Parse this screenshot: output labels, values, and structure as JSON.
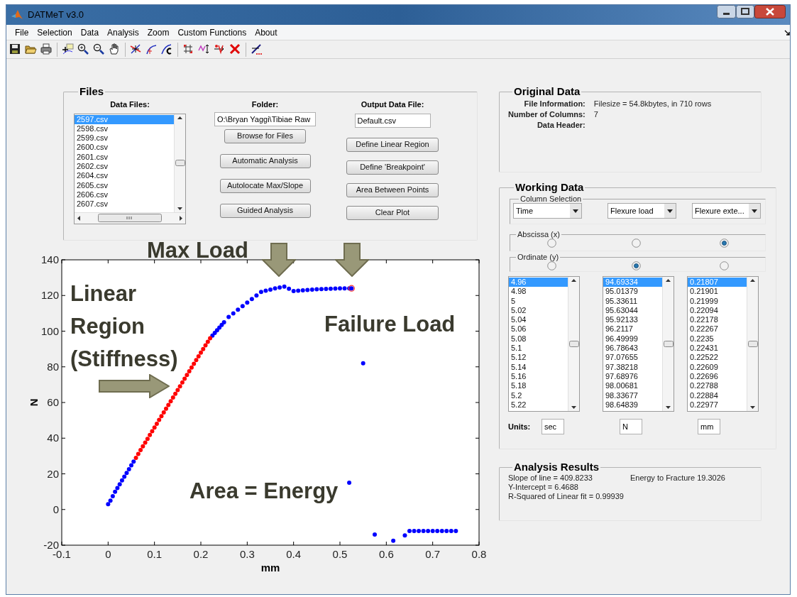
{
  "window": {
    "title": "DATMeT v3.0"
  },
  "menu": [
    "File",
    "Selection",
    "Data",
    "Analysis",
    "Zoom",
    "Custom Functions",
    "About"
  ],
  "files": {
    "title": "Files",
    "data_files_label": "Data Files:",
    "data_files": [
      {
        "name": "2597.csv",
        "selected": true
      },
      {
        "name": "2598.csv",
        "selected": false
      },
      {
        "name": "2599.csv",
        "selected": false
      },
      {
        "name": "2600.csv",
        "selected": false
      },
      {
        "name": "2601.csv",
        "selected": false
      },
      {
        "name": "2602.csv",
        "selected": false
      },
      {
        "name": "2604.csv",
        "selected": false
      },
      {
        "name": "2605.csv",
        "selected": false
      },
      {
        "name": "2606.csv",
        "selected": false
      },
      {
        "name": "2607.csv",
        "selected": false
      }
    ],
    "folder_label": "Folder:",
    "folder": "O:\\Bryan Yaggi\\Tibiae Raw",
    "folder_buttons": [
      "Browse for Files",
      "Automatic Analysis",
      "Autolocate Max/Slope",
      "Guided Analysis"
    ],
    "output_label": "Output Data File:",
    "output_file": "Default.csv",
    "output_buttons": [
      "Define Linear Region",
      "Define 'Breakpoint'",
      "Area Between Points",
      "Clear Plot"
    ]
  },
  "plot": {
    "chart_data": {
      "type": "scatter",
      "xlabel": "mm",
      "ylabel": "N",
      "xlim": [
        -0.1,
        0.8
      ],
      "ylim": [
        -20,
        140
      ],
      "xticks": [
        -0.1,
        0,
        0.1,
        0.2,
        0.3,
        0.4,
        0.5,
        0.6,
        0.7,
        0.8
      ],
      "yticks": [
        -20,
        0,
        20,
        40,
        60,
        80,
        100,
        120,
        140
      ],
      "x": [
        0,
        0.005,
        0.01,
        0.015,
        0.02,
        0.025,
        0.03,
        0.035,
        0.04,
        0.045,
        0.05,
        0.055,
        0.06,
        0.065,
        0.07,
        0.075,
        0.08,
        0.085,
        0.09,
        0.095,
        0.1,
        0.105,
        0.11,
        0.115,
        0.12,
        0.125,
        0.13,
        0.135,
        0.14,
        0.145,
        0.15,
        0.155,
        0.16,
        0.165,
        0.17,
        0.175,
        0.18,
        0.185,
        0.19,
        0.195,
        0.2,
        0.205,
        0.21,
        0.215,
        0.22,
        0.225,
        0.23,
        0.235,
        0.24,
        0.245,
        0.25,
        0.26,
        0.27,
        0.28,
        0.29,
        0.3,
        0.31,
        0.32,
        0.33,
        0.34,
        0.35,
        0.36,
        0.37,
        0.38,
        0.39,
        0.4,
        0.41,
        0.42,
        0.43,
        0.44,
        0.45,
        0.46,
        0.47,
        0.48,
        0.49,
        0.5,
        0.51,
        0.52,
        0.525,
        0.55,
        0.575,
        0.615,
        0.64,
        0.65,
        0.66,
        0.67,
        0.68,
        0.69,
        0.7,
        0.71,
        0.72,
        0.73,
        0.74,
        0.75
      ],
      "series": [
        {
          "color": "#0000ff",
          "values": [
            3,
            5,
            7.5,
            10,
            12,
            14.1,
            16.3,
            18.4,
            20.5,
            22.6,
            24.8,
            26.9,
            null,
            null,
            null,
            null,
            null,
            null,
            null,
            null,
            null,
            null,
            null,
            null,
            null,
            null,
            null,
            null,
            null,
            null,
            null,
            null,
            null,
            null,
            null,
            null,
            null,
            null,
            null,
            null,
            null,
            null,
            null,
            null,
            null,
            97.5,
            99,
            100.5,
            102,
            103.5,
            105,
            108,
            110,
            112,
            114,
            116,
            118,
            120,
            122,
            122.7,
            123.3,
            124,
            124.5,
            125,
            123.8,
            122.5,
            122.7,
            122.9,
            123.1,
            123.3,
            123.5,
            123.6,
            123.7,
            123.8,
            123.9,
            124,
            124,
            124,
            124,
            82,
            -14,
            -17.5,
            -14.5,
            -12,
            -12,
            -12,
            -12,
            -12,
            -12,
            -12,
            -12,
            -12,
            -12,
            -12
          ]
        },
        {
          "color": "#ff0000",
          "values": [
            null,
            null,
            null,
            null,
            null,
            null,
            null,
            null,
            null,
            null,
            null,
            null,
            29,
            31.1,
            33.3,
            35.4,
            37.5,
            39.6,
            41.8,
            43.9,
            46,
            48.1,
            50.2,
            52.3,
            54.4,
            56.5,
            58.6,
            60.7,
            62.8,
            64.9,
            67,
            69.1,
            71.2,
            73.3,
            75.4,
            77.5,
            79.6,
            81.7,
            83.8,
            85.9,
            88,
            90,
            92,
            94,
            96,
            null,
            null,
            null,
            null,
            null,
            null,
            null,
            null,
            null,
            null,
            null,
            null,
            null,
            null,
            null,
            null,
            null,
            null,
            null,
            null,
            null,
            null,
            null,
            null,
            null,
            null,
            null,
            null,
            null,
            null,
            null,
            null,
            null,
            null,
            null,
            null,
            null,
            null,
            null,
            null,
            null,
            null,
            null,
            null,
            null,
            null,
            null,
            null,
            null
          ]
        },
        {
          "color": "#0000ff",
          "values": [
            null,
            null,
            null,
            null,
            null,
            null,
            null,
            null,
            null,
            null,
            null,
            null,
            null,
            null,
            null,
            null,
            null,
            null,
            null,
            null,
            null,
            null,
            null,
            null,
            null,
            null,
            null,
            null,
            null,
            null,
            null,
            null,
            null,
            null,
            null,
            null,
            null,
            null,
            null,
            null,
            null,
            null,
            null,
            null,
            null,
            null,
            null,
            null,
            null,
            null,
            null,
            null,
            null,
            null,
            null,
            null,
            null,
            null,
            null,
            null,
            null,
            null,
            null,
            null,
            null,
            null,
            null,
            null,
            null,
            null,
            null,
            null,
            null,
            null,
            null,
            null,
            null,
            15,
            null,
            null,
            null,
            null,
            null,
            null,
            null,
            null,
            null,
            null,
            null,
            null,
            null,
            null,
            null,
            null
          ]
        }
      ],
      "annotations": [
        {
          "text": "Max Load"
        },
        {
          "text": "Failure Load"
        },
        {
          "text": "Linear Region (Stiffness)"
        },
        {
          "text": "Area = Energy"
        }
      ]
    }
  },
  "original_data": {
    "title": "Original Data",
    "rows": [
      {
        "label": "File Information:",
        "value": "Filesize = 54.8kbytes, in 710 rows"
      },
      {
        "label": "Number of Columns:",
        "value": "7"
      },
      {
        "label": "Data Header:"
      }
    ]
  },
  "working_data": {
    "title": "Working Data",
    "column_selection_title": "Column Selection",
    "abscissa_title": "Abscissa (x)",
    "ordinate_title": "Ordinate (y)",
    "units_label": "Units:",
    "columns": [
      {
        "dropdown": "Time",
        "abscissa_selected": false,
        "ordinate_selected": false,
        "unit": "sec",
        "values": [
          {
            "text": "4.96",
            "selected": true
          },
          {
            "text": "4.98",
            "selected": false
          },
          {
            "text": "5",
            "selected": false
          },
          {
            "text": "5.02",
            "selected": false
          },
          {
            "text": "5.04",
            "selected": false
          },
          {
            "text": "5.06",
            "selected": false
          },
          {
            "text": "5.08",
            "selected": false
          },
          {
            "text": "5.1",
            "selected": false
          },
          {
            "text": "5.12",
            "selected": false
          },
          {
            "text": "5.14",
            "selected": false
          },
          {
            "text": "5.16",
            "selected": false
          },
          {
            "text": "5.18",
            "selected": false
          },
          {
            "text": "5.2",
            "selected": false
          },
          {
            "text": "5.22",
            "selected": false
          }
        ]
      },
      {
        "dropdown": "Flexure load",
        "abscissa_selected": false,
        "ordinate_selected": true,
        "unit": "N",
        "values": [
          {
            "text": "94.69334",
            "selected": true
          },
          {
            "text": "95.01379",
            "selected": false
          },
          {
            "text": "95.33611",
            "selected": false
          },
          {
            "text": "95.63044",
            "selected": false
          },
          {
            "text": "95.92133",
            "selected": false
          },
          {
            "text": "96.2117",
            "selected": false
          },
          {
            "text": "96.49999",
            "selected": false
          },
          {
            "text": "96.78643",
            "selected": false
          },
          {
            "text": "97.07655",
            "selected": false
          },
          {
            "text": "97.38218",
            "selected": false
          },
          {
            "text": "97.68976",
            "selected": false
          },
          {
            "text": "98.00681",
            "selected": false
          },
          {
            "text": "98.33677",
            "selected": false
          },
          {
            "text": "98.64839",
            "selected": false
          }
        ]
      },
      {
        "dropdown": "Flexure exte...",
        "abscissa_selected": true,
        "ordinate_selected": false,
        "unit": "mm",
        "values": [
          {
            "text": "0.21807",
            "selected": true
          },
          {
            "text": "0.21901",
            "selected": false
          },
          {
            "text": "0.21999",
            "selected": false
          },
          {
            "text": "0.22094",
            "selected": false
          },
          {
            "text": "0.22178",
            "selected": false
          },
          {
            "text": "0.22267",
            "selected": false
          },
          {
            "text": "0.2235",
            "selected": false
          },
          {
            "text": "0.22431",
            "selected": false
          },
          {
            "text": "0.22522",
            "selected": false
          },
          {
            "text": "0.22609",
            "selected": false
          },
          {
            "text": "0.22696",
            "selected": false
          },
          {
            "text": "0.22788",
            "selected": false
          },
          {
            "text": "0.22884",
            "selected": false
          },
          {
            "text": "0.22977",
            "selected": false
          }
        ]
      }
    ]
  },
  "analysis_results": {
    "title": "Analysis Results",
    "lines": [
      "Slope of line = 409.8233",
      "Energy to Fracture 19.3026",
      "Y-Intercept = 6.4688",
      "R-Squared of Linear fit = 0.99939"
    ]
  }
}
